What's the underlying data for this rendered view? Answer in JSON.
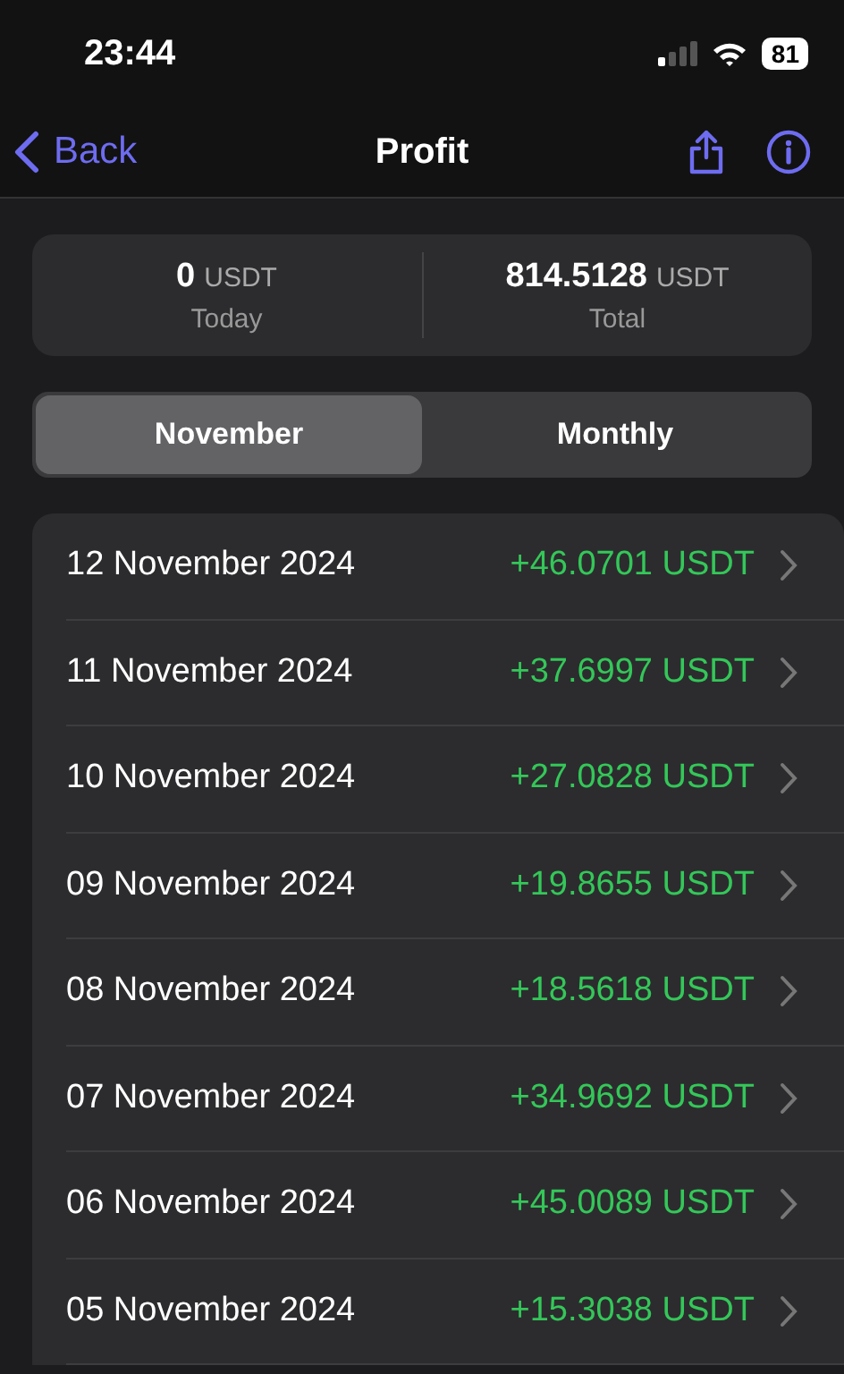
{
  "status_bar": {
    "time": "23:44",
    "battery": "81"
  },
  "nav": {
    "back": "Back",
    "title": "Profit"
  },
  "summary": [
    {
      "value": "0",
      "unit": "USDT",
      "label": "Today"
    },
    {
      "value": "814.5128",
      "unit": "USDT",
      "label": "Total"
    }
  ],
  "segments": [
    {
      "label": "November",
      "selected": true
    },
    {
      "label": "Monthly",
      "selected": false
    }
  ],
  "rows": [
    {
      "date": "12 November 2024",
      "amount": "+46.0701 USDT"
    },
    {
      "date": "11 November 2024",
      "amount": "+37.6997 USDT"
    },
    {
      "date": "10 November 2024",
      "amount": "+27.0828 USDT"
    },
    {
      "date": "09 November 2024",
      "amount": "+19.8655 USDT"
    },
    {
      "date": "08 November 2024",
      "amount": "+18.5618 USDT"
    },
    {
      "date": "07 November 2024",
      "amount": "+34.9692 USDT"
    },
    {
      "date": "06 November 2024",
      "amount": "+45.0089 USDT"
    },
    {
      "date": "05 November 2024",
      "amount": "+15.3038 USDT"
    }
  ]
}
